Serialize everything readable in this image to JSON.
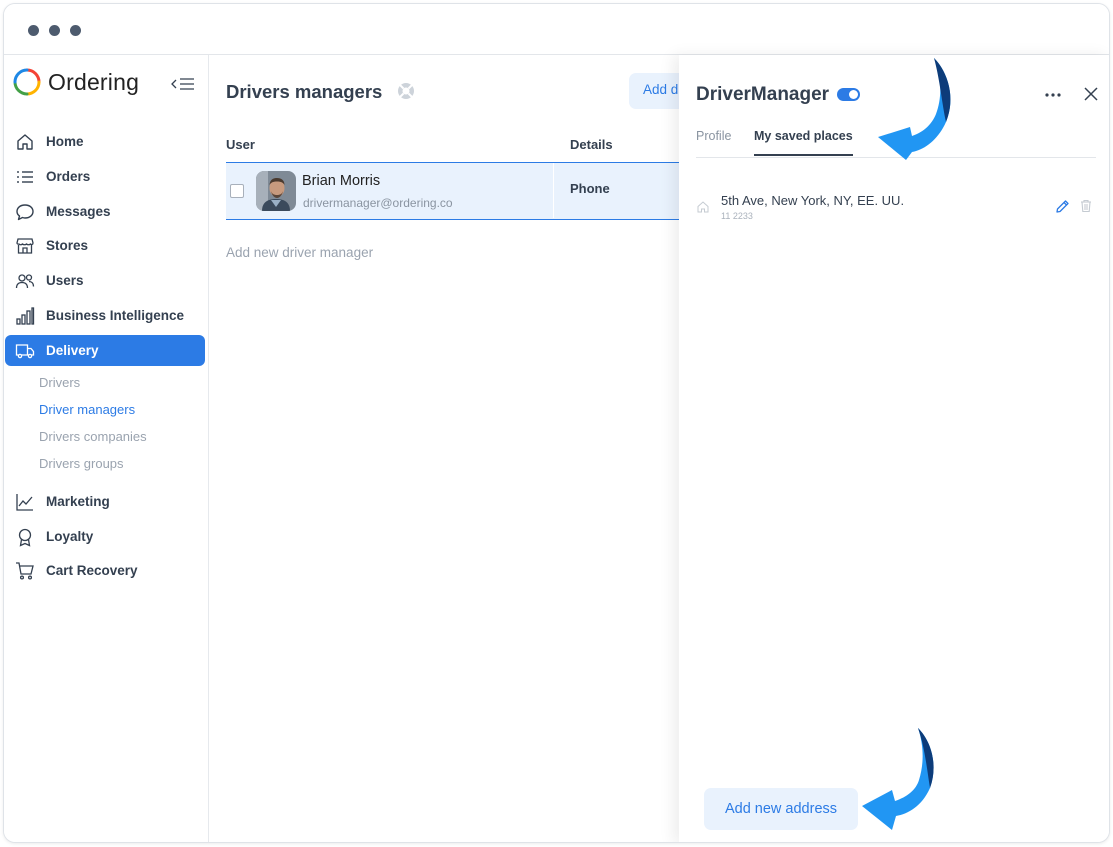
{
  "app": {
    "brand": "Ordering"
  },
  "sidebar": {
    "items": [
      {
        "label": "Home",
        "icon": "home-icon"
      },
      {
        "label": "Orders",
        "icon": "list-icon"
      },
      {
        "label": "Messages",
        "icon": "message-icon"
      },
      {
        "label": "Stores",
        "icon": "store-icon"
      },
      {
        "label": "Users",
        "icon": "users-icon"
      },
      {
        "label": "Business Intelligence",
        "icon": "bar-chart-icon"
      },
      {
        "label": "Delivery",
        "icon": "truck-icon",
        "active": true
      },
      {
        "label": "Marketing",
        "icon": "line-chart-icon"
      },
      {
        "label": "Loyalty",
        "icon": "award-icon"
      },
      {
        "label": "Cart Recovery",
        "icon": "cart-icon"
      }
    ],
    "delivery_sub": [
      {
        "label": "Drivers"
      },
      {
        "label": "Driver managers",
        "current": true
      },
      {
        "label": "Drivers companies"
      },
      {
        "label": "Drivers groups"
      }
    ]
  },
  "main": {
    "title": "Drivers managers",
    "add_button": "Add d",
    "columns": {
      "user": "User",
      "details": "Details"
    },
    "rows": [
      {
        "name": "Brian Morris",
        "email": "drivermanager@ordering.co",
        "details": "Phone"
      }
    ],
    "add_link": "Add new driver manager"
  },
  "panel": {
    "title": "DriverManager",
    "enabled": true,
    "tabs": [
      {
        "label": "Profile"
      },
      {
        "label": "My saved places",
        "active": true
      }
    ],
    "addresses": [
      {
        "address": "5th Ave, New York, NY, EE. UU.",
        "detail": "11 2233"
      }
    ],
    "add_address": "Add new address"
  },
  "colors": {
    "accent": "#2c7be5",
    "text": "#344050",
    "muted": "#8a94a1",
    "highlight": "#e9f2fd",
    "annotation_arrow": "#2196f3"
  }
}
